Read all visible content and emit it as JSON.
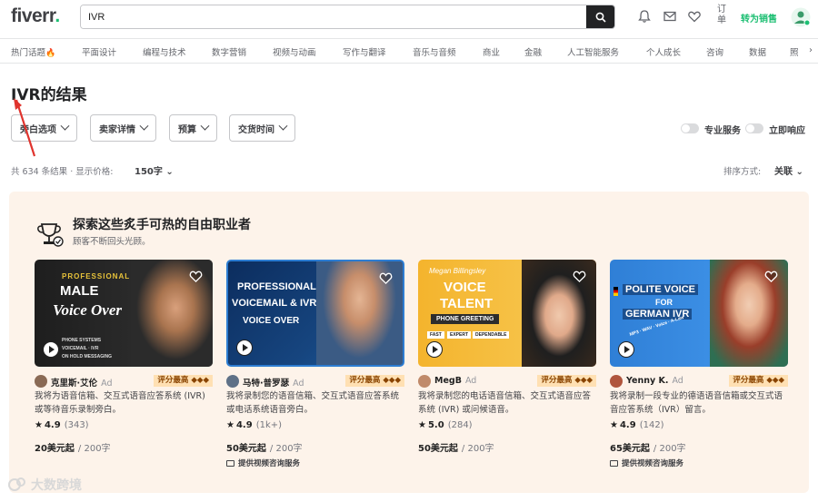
{
  "header": {
    "logo_text": "fiverr",
    "logo_dot": ".",
    "search_value": "IVR",
    "orders_label": "订单",
    "switch_seller": "转为销售"
  },
  "categories": [
    "热门话题",
    "平面设计",
    "编程与技术",
    "数字营销",
    "视频与动画",
    "写作与翻译",
    "音乐与音频",
    "商业",
    "金融",
    "人工智能服务",
    "个人成长",
    "咨询",
    "数据",
    "照"
  ],
  "hot_icon": "🔥",
  "results": {
    "title": "IVR的结果",
    "filters": [
      "旁白选项",
      "卖家详情",
      "预算",
      "交货时间"
    ],
    "toggles": [
      "专业服务",
      "立即响应"
    ],
    "count_text": "共 634 条结果 · 显示价格:",
    "price_display": "150字",
    "sort_label": "排序方式:",
    "sort_value": "关联"
  },
  "showcase": {
    "title": "探索这些炙手可热的自由职业者",
    "subtitle": "顾客不断回头光顾。",
    "cards": [
      {
        "thumb_lines": [
          "PROFESSIONAL",
          "MALE",
          "Voice Over",
          "PHONE SYSTEMS",
          "VOICEMAIL · IVR",
          "ON HOLD MESSAGING"
        ],
        "seller": "克里斯·艾伦",
        "ad": "Ad",
        "level": "评分最高 ◆◆◆",
        "description": "我将为语音信箱、交互式语音应答系统 (IVR) 或等待音乐录制旁白。",
        "rating": "4.9",
        "reviews": "(343)",
        "price": "20美元起",
        "per": "/ 200字",
        "consult": ""
      },
      {
        "thumb_lines": [
          "PROFESSIONAL",
          "VOICEMAIL & IVR",
          "VOICE OVER"
        ],
        "seller": "马特·普罗瑟",
        "ad": "Ad",
        "level": "评分最高 ◆◆◆",
        "description": "我将录制您的语音信箱、交互式语音应答系统或电话系统语音旁白。",
        "rating": "4.9",
        "reviews": "(1k+)",
        "price": "50美元起",
        "per": "/ 200字",
        "consult": "提供视频咨询服务"
      },
      {
        "thumb_lines": [
          "Megan Billingsley",
          "VOICE",
          "TALENT",
          "PHONE GREETING",
          "FAST",
          "EXPERT",
          "DEPENDABLE"
        ],
        "seller": "MegB",
        "ad": "Ad",
        "level": "评分最高 ◆◆◆",
        "description": "我将录制您的电话语音信箱、交互式语音应答系统 (IVR) 或问候语音。",
        "rating": "5.0",
        "reviews": "(284)",
        "price": "50美元起",
        "per": "/ 200字",
        "consult": ""
      },
      {
        "thumb_lines": [
          "POLITE VOICE",
          "FOR",
          "GERMAN IVR",
          "MP3 · WAV · Voice · A-Law"
        ],
        "seller": "Yenny K.",
        "ad": "Ad",
        "level": "评分最高 ◆◆◆",
        "description": "我将录制一段专业的德语语音信箱或交互式语音应答系统（IVR）留言。",
        "rating": "4.9",
        "reviews": "(142)",
        "price": "65美元起",
        "per": "/ 200字",
        "consult": "提供视频咨询服务"
      }
    ]
  },
  "watermark": "大数跨境",
  "colors": {
    "brand_green": "#1dbf73",
    "panel_bg": "#fdf3ea",
    "level_badge": "#ffe0b3",
    "arrow_red": "#e0342e"
  }
}
